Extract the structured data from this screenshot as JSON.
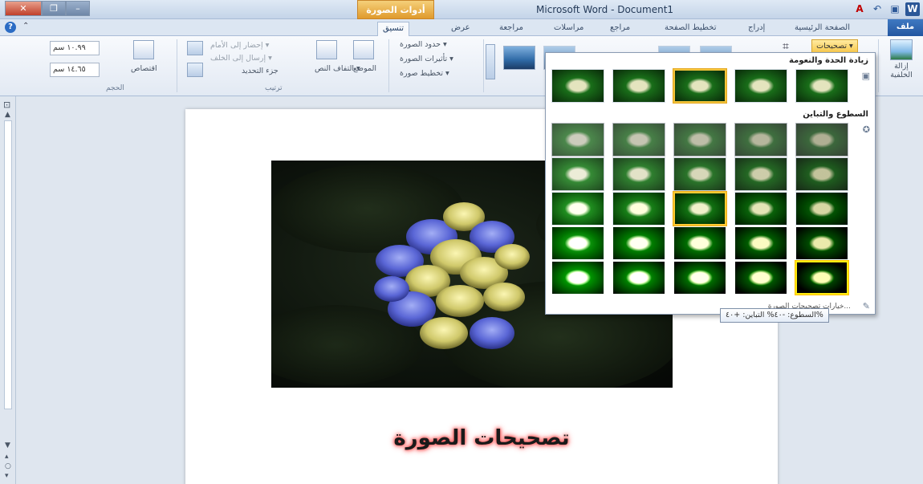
{
  "window": {
    "title": "Microsoft Word - Document1",
    "context_tab_header": "أدوات الصورة"
  },
  "quick_access": {
    "items": [
      "word-icon",
      "save-icon",
      "undo-icon",
      "font-color-icon"
    ]
  },
  "tabs": [
    {
      "label": "ملف",
      "name": "tab-file"
    },
    {
      "label": "الصفحة الرئيسية",
      "name": "tab-home"
    },
    {
      "label": "إدراج",
      "name": "tab-insert"
    },
    {
      "label": "تخطيط الصفحة",
      "name": "tab-page-layout"
    },
    {
      "label": "مراجع",
      "name": "tab-references"
    },
    {
      "label": "مراسلات",
      "name": "tab-mailings"
    },
    {
      "label": "مراجعة",
      "name": "tab-review"
    },
    {
      "label": "عرض",
      "name": "tab-view"
    },
    {
      "label": "تنسيق",
      "name": "tab-format"
    }
  ],
  "ribbon": {
    "adjust": {
      "remove_background": "إزالة الخلفية",
      "corrections": "تصحيحات ▾"
    },
    "picture_styles": {
      "picture_border": "حدود الصورة ▾",
      "picture_effects": "تأثيرات الصورة ▾",
      "picture_layout": "تخطيط صورة ▾"
    },
    "arrange": {
      "label": "ترتيب",
      "position": "الموضع",
      "wrap_text": "التفاف النص ▾",
      "bring_forward": "إحضار إلى الأمام ▾",
      "send_backward": "إرسال إلى الخلف ▾",
      "selection_pane": "جزء التحديد"
    },
    "size": {
      "label": "الحجم",
      "crop": "اقتصاص",
      "height": "١٠.٩٩ سم",
      "width": "١٤.٦٥ سم"
    }
  },
  "document": {
    "caption": "تصحيحات الصورة"
  },
  "gallery": {
    "section1_title": "زيادة الحدة والنعومة",
    "section2_title": "السطوع والتباين",
    "footer": "خيارات تصحيحات الصورة...",
    "tooltip": "السطوع: -٤٠% التباين: +٤٠%"
  }
}
